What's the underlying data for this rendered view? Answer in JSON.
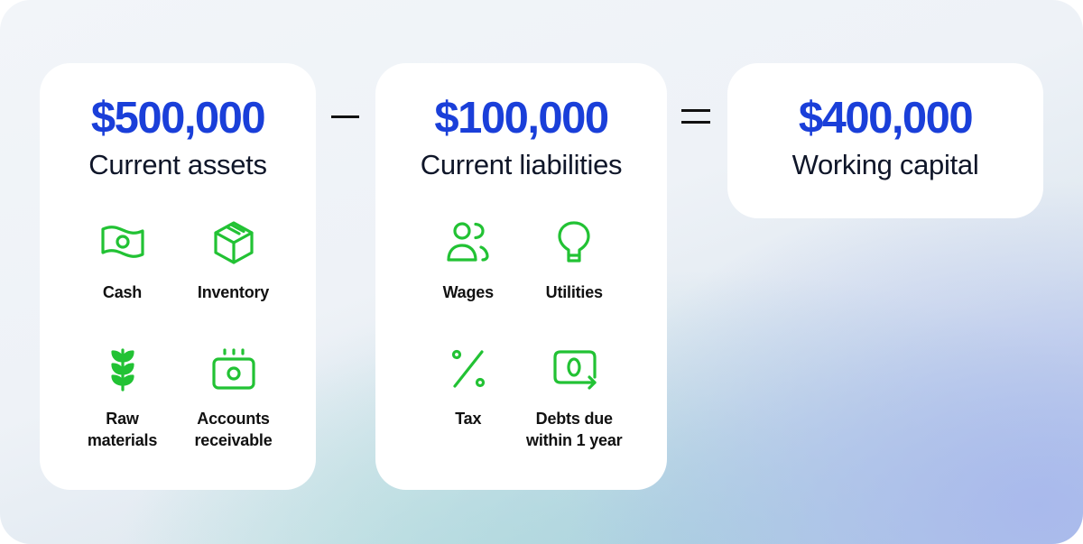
{
  "operators": {
    "minus": "−",
    "equals": "="
  },
  "colors": {
    "amount": "#1a3fd9",
    "icon": "#22c234",
    "label": "#0f1629"
  },
  "cards": {
    "assets": {
      "amount": "$500,000",
      "label": "Current assets",
      "items": [
        {
          "icon": "cash-icon",
          "label": "Cash"
        },
        {
          "icon": "box-icon",
          "label": "Inventory"
        },
        {
          "icon": "plant-icon",
          "label": "Raw\nmaterials"
        },
        {
          "icon": "invoice-money-icon",
          "label": "Accounts\nreceivable"
        }
      ]
    },
    "liabilities": {
      "amount": "$100,000",
      "label": "Current liabilities",
      "items": [
        {
          "icon": "people-icon",
          "label": "Wages"
        },
        {
          "icon": "lightbulb-icon",
          "label": "Utilities"
        },
        {
          "icon": "percent-icon",
          "label": "Tax"
        },
        {
          "icon": "money-arrow-icon",
          "label": "Debts due\nwithin 1 year"
        }
      ]
    },
    "result": {
      "amount": "$400,000",
      "label": "Working capital"
    }
  }
}
